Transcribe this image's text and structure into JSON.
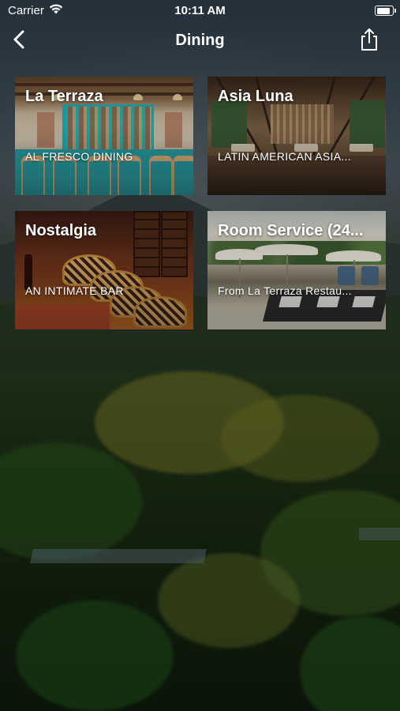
{
  "status_bar": {
    "carrier": "Carrier",
    "time": "10:11 AM",
    "battery_level": 1.0
  },
  "nav": {
    "title": "Dining",
    "back_icon": "chevron-left-icon",
    "share_icon": "share-icon"
  },
  "tiles": [
    {
      "title": "La Terraza",
      "subtitle": "AL FRESCO DINING"
    },
    {
      "title": "Asia Luna",
      "subtitle": "LATIN AMERICAN ASIA..."
    },
    {
      "title": "Nostalgia",
      "subtitle": "AN INTIMATE BAR"
    },
    {
      "title": "Room Service (24...",
      "subtitle": "From La Terraza Restau..."
    }
  ]
}
